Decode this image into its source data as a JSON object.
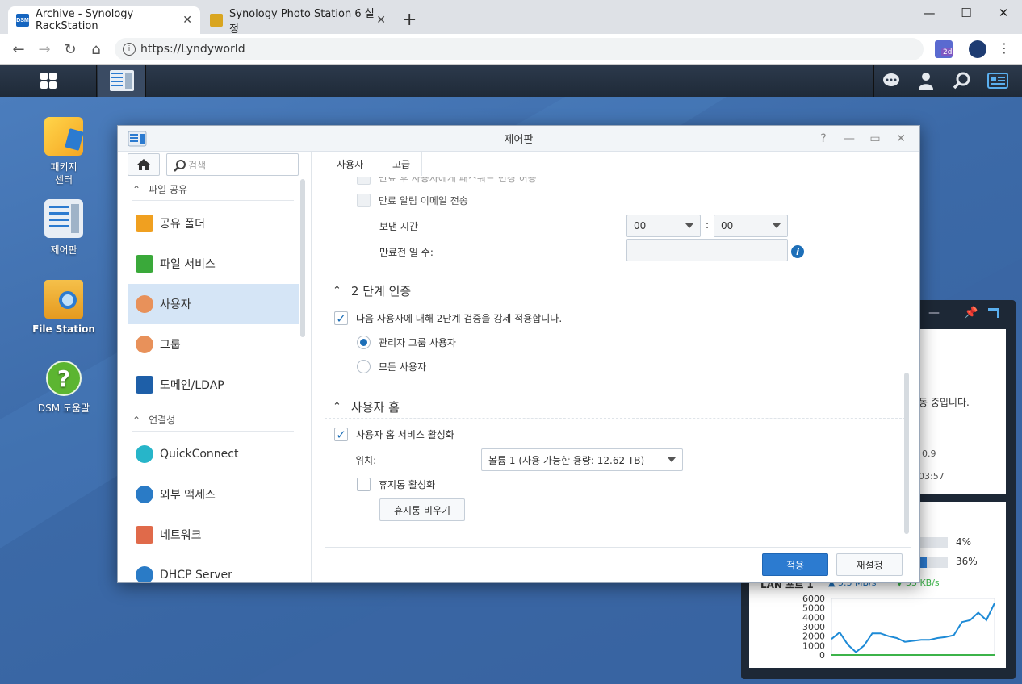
{
  "browser": {
    "tabs": [
      {
        "label": "Archive - Synology RackStation",
        "favicon": "DSM"
      },
      {
        "label": "Synology Photo Station 6 설정"
      }
    ],
    "new_tab": "+",
    "url": "https://Lyndyworld",
    "ext_badge": "2d"
  },
  "desktop": {
    "icons": [
      {
        "label": "패키지\n센터"
      },
      {
        "label": "제어판"
      },
      {
        "label": "File Station"
      },
      {
        "label": "DSM 도움말"
      }
    ]
  },
  "widget": {
    "partial_texts": [
      "동 중입니다.",
      "0.9",
      "03:57"
    ],
    "cpu_pct": "4%",
    "ram_pct": "36%",
    "cpu_value": 0.04,
    "ram_value": 0.36,
    "lan_label": "LAN 포트 1",
    "upload": "5.3 MB/s",
    "download": "33 KB/s",
    "chart_yticks": [
      "6000",
      "5000",
      "4000",
      "3000",
      "2000",
      "1000",
      "0"
    ],
    "chart_upload": [
      1700,
      2400,
      1100,
      300,
      1000,
      2300,
      2300,
      2000,
      1800,
      1400,
      1500,
      1600,
      1600,
      1800,
      1900,
      2100,
      3500,
      3700,
      4500,
      3700,
      5500
    ],
    "chart_download": [
      0,
      0,
      0,
      0,
      0,
      0,
      0,
      0,
      0,
      0,
      0,
      0,
      0,
      0,
      0,
      0,
      0,
      0,
      0,
      0,
      0
    ],
    "colors": {
      "upload": "#1d8ad6",
      "download": "#3cb34a"
    }
  },
  "window": {
    "title": "제어판",
    "search_placeholder": "검색",
    "sidebar": {
      "groups": [
        {
          "label": "파일 공유"
        },
        {
          "label": "연결성"
        }
      ],
      "items": [
        {
          "label": "공유 폴더",
          "color": "#f0a020"
        },
        {
          "label": "파일 서비스",
          "color": "#3aa93a"
        },
        {
          "label": "사용자",
          "color": "#e8915a"
        },
        {
          "label": "그룹",
          "color": "#e8915a"
        },
        {
          "label": "도메인/LDAP",
          "color": "#1e5fa8"
        },
        {
          "label": "QuickConnect",
          "color": "#27b5c9"
        },
        {
          "label": "외부 액세스",
          "color": "#2a7bc6"
        },
        {
          "label": "네트워크",
          "color": "#e06a4a"
        },
        {
          "label": "DHCP Server",
          "color": "#2a7bc6"
        }
      ]
    },
    "tabs": [
      "사용자",
      "고급"
    ],
    "content": {
      "cut_text": "만료 후 사용자에게 패스워드 변경 허용",
      "expiry_email": "만료 알림 이메일 전송",
      "send_time_label": "보낸 시간",
      "hour": "00",
      "minute": "00",
      "time_sep": ":",
      "days_before_label": "만료전 일 수:",
      "sec_2fa": "2 단계 인증",
      "enforce_2fa": "다음 사용자에 대해 2단계 검증을 강제 적용합니다.",
      "radio_admins": "관리자 그룹 사용자",
      "radio_all": "모든 사용자",
      "sec_home": "사용자 홈",
      "home_enable": "사용자 홈 서비스 활성화",
      "location_label": "위치:",
      "location_value": "볼륨 1 (사용 가능한 용량: 12.62 TB)",
      "recycle_enable": "휴지통 활성화",
      "empty_recycle": "휴지통 비우기"
    },
    "buttons": {
      "apply": "적용",
      "reset": "재설정"
    }
  }
}
